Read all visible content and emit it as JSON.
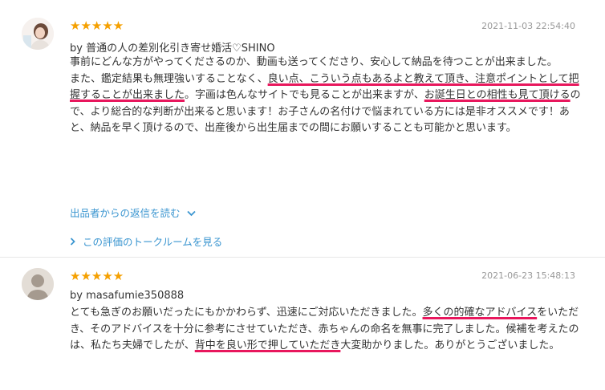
{
  "reviews": [
    {
      "stars": "★★★★★",
      "date": "2021-11-03 22:54:40",
      "byline": "by 普通の人の差別化引き寄せ婚活♡SHINO",
      "para1": "事前にどんな方がやってくださるのか、動画も送ってくださり、安心して納品を待つことが出来ました。",
      "p2_a": "また、鑑定結果も無理強いすることなく、",
      "p2_hl1": "良い点、こういう点もあるよと教えて頂き、注意ポイントとして把握することが出来ました",
      "p2_b": "。字画は色んなサイトでも見ることが出来ますが、",
      "p2_hl2": "お誕生日との相性も見て頂ける",
      "p2_c": "ので、より総合的な判断が出来ると思います！お子さんの名付けで悩まれている方には是非オススメです！あと、納品を早く頂けるので、出産後から出生届までの間にお願いすることも可能かと思います。",
      "reply_link": "出品者からの返信を読む",
      "talk_link": "この評価のトークルームを見る"
    },
    {
      "stars": "★★★★★",
      "date": "2021-06-23 15:48:13",
      "byline": "by masafumie350888",
      "p_a": "とても急ぎのお願いだったにもかかわらず、迅速にご対応いただきました。",
      "p_hl1": "多くの的確なアドバイス",
      "p_b": "をいただき、そのアドバイスを十分に参考にさせていただき、赤ちゃんの命名を無事に完了しました。候補を考えたのは、私たち夫婦でしたが、",
      "p_hl2": "背中を良い形で押していただき",
      "p_c": "大変助かりました。ありがとうございました。"
    }
  ],
  "colors": {
    "accent_link": "#3a95d0",
    "star": "#f5a000",
    "highlight_underline": "#e8175d"
  },
  "icons": {
    "reply_chevron": "chevron-down-icon",
    "talk_chevron": "chevron-right-icon"
  }
}
